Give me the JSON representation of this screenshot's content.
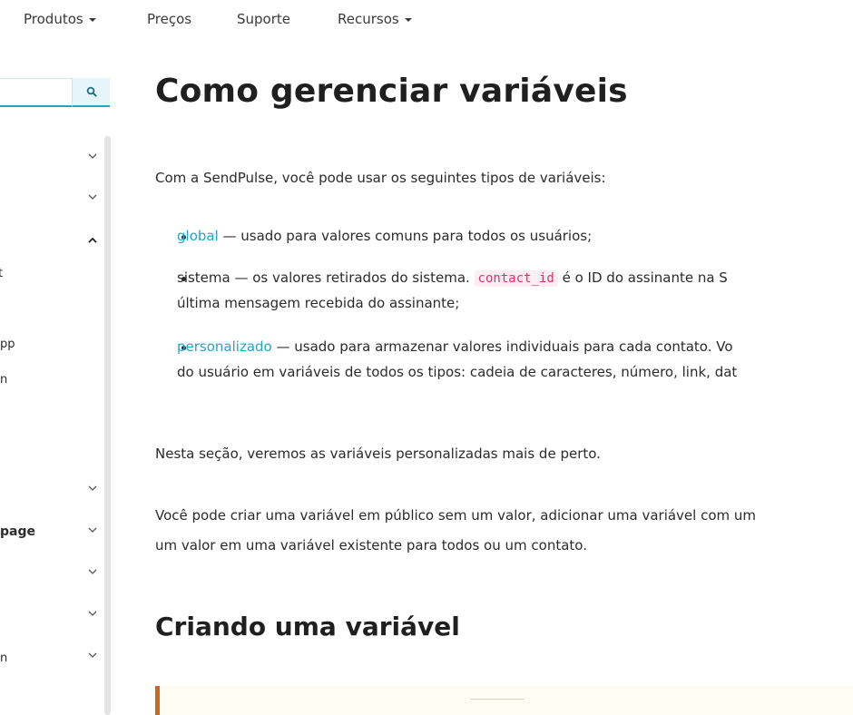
{
  "nav": {
    "items": [
      {
        "label": "Produtos",
        "dropdown": true
      },
      {
        "label": "Preços",
        "dropdown": false
      },
      {
        "label": "Suporte",
        "dropdown": false
      },
      {
        "label": "Recursos",
        "dropdown": true
      }
    ]
  },
  "sidebar": {
    "search": {
      "value": "",
      "placeholder": ""
    },
    "fragments": [
      "t",
      "pp",
      "n",
      "page",
      "n"
    ]
  },
  "article": {
    "title": "Como gerenciar variáveis",
    "intro": "Com a SendPulse, você pode usar os seguintes tipos de variáveis:",
    "list": [
      {
        "term": "global",
        "line1": " — usado para valores comuns para todos os usuários;"
      },
      {
        "term": "sistema",
        "line1_pre": " — os valores retirados do sistema. ",
        "code": "contact_id",
        "line1_post": " é o ID do assinante na S",
        "line2": "última mensagem recebida do assinante;"
      },
      {
        "term": "personalizado",
        "line1": " — usado para armazenar valores individuais para cada contato. Vo",
        "line2": "do usuário em variáveis de todos os tipos: cadeia de caracteres, número, link, dat"
      }
    ],
    "para1": "Nesta seção, veremos as variáveis personalizadas mais de perto.",
    "para2_line1": "Você pode criar uma variável em público sem um valor, adicionar uma variável com um",
    "para2_line2": "um valor em uma variável existente para todos ou um contato.",
    "subtitle": "Criando uma variável"
  },
  "colors": {
    "link": "#1fa7c6",
    "code_text": "#d6336c",
    "note_border": "#c9691f",
    "note_bg": "#fffcf3"
  }
}
